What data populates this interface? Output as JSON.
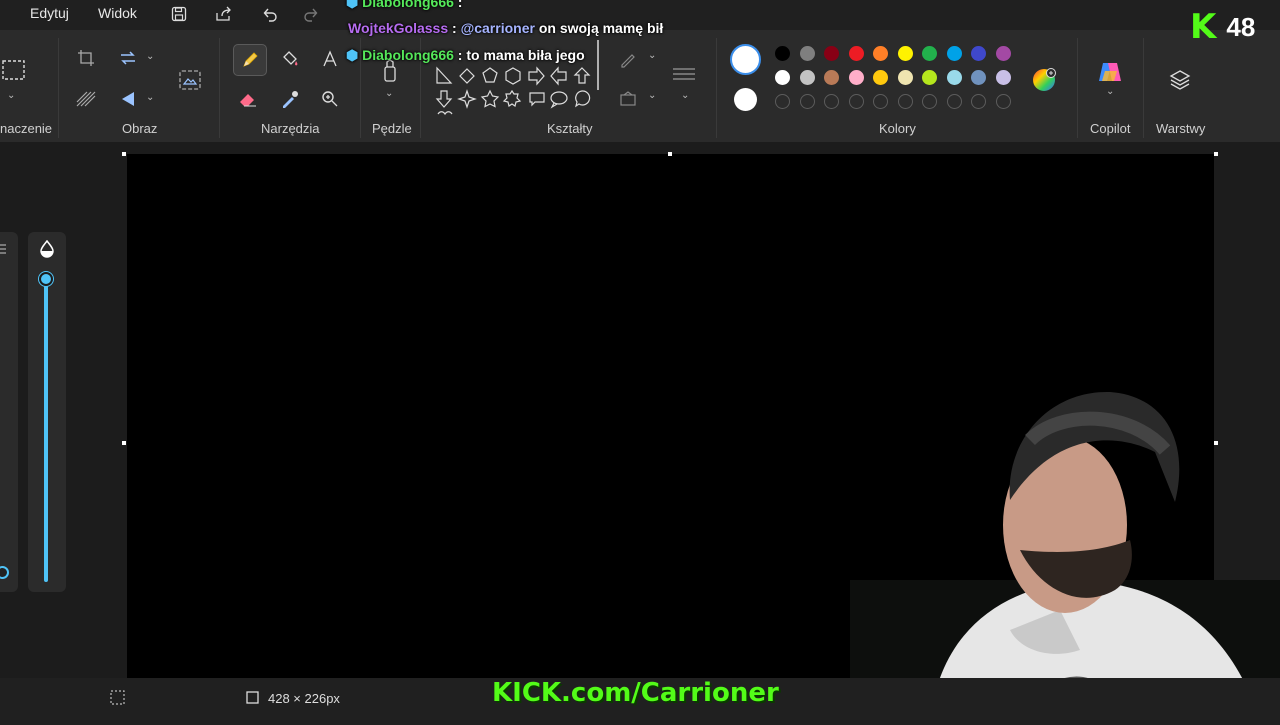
{
  "menu": {
    "edit": "Edytuj",
    "view": "Widok"
  },
  "ribbon": {
    "groups": {
      "selection": "naczenie",
      "image": "Obraz",
      "tools": "Narzędzia",
      "brushes": "Pędzle",
      "shapes": "Kształty",
      "colors": "Kolory",
      "copilot": "Copilot",
      "layers": "Warstwy"
    }
  },
  "colors": {
    "row1": [
      "#000000",
      "#7f7f7f",
      "#880015",
      "#ed1c24",
      "#ff7f27",
      "#fff200",
      "#22b14c",
      "#00a2e8",
      "#3f48cc",
      "#a349a4"
    ],
    "row2": [
      "#ffffff",
      "#c3c3c3",
      "#b97a57",
      "#ffaec9",
      "#ffc90e",
      "#efe4b0",
      "#b5e61d",
      "#99d9ea",
      "#7092be",
      "#c8bfe7"
    ],
    "primary": "#ffffff",
    "secondary": "#ffffff"
  },
  "status": {
    "canvas_size": "428 × 226px"
  },
  "chat": [
    {
      "user": "Diabolong666",
      "sep": " :",
      "message": ""
    },
    {
      "user": "WojtekGolasss",
      "sep": " : ",
      "mention": "@carrioner",
      "message": " on swoją mamę bił"
    },
    {
      "user": "Diabolong666",
      "sep": " : ",
      "message": "to mama biła jego"
    }
  ],
  "overlay": {
    "viewer_count": "48",
    "kick_logo": "K",
    "kick_url": "KICK.com/Carrioner"
  }
}
